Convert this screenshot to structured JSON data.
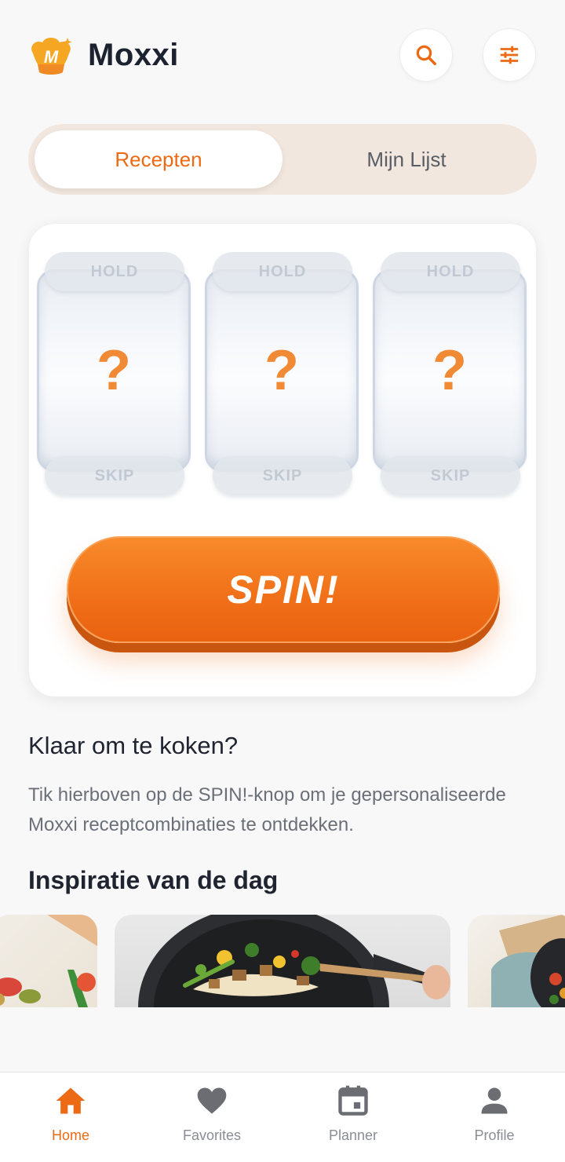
{
  "app": {
    "title": "Moxxi",
    "brand_color": "#EC6A14"
  },
  "header": {
    "search_icon": "search-icon",
    "filter_icon": "sliders-icon"
  },
  "tabs": [
    {
      "label": "Recepten",
      "active": true
    },
    {
      "label": "Mijn Lijst",
      "active": false
    }
  ],
  "slot_machine": {
    "reels": [
      {
        "symbol": "?",
        "hold_label": "HOLD",
        "skip_label": "SKIP"
      },
      {
        "symbol": "?",
        "hold_label": "HOLD",
        "skip_label": "SKIP"
      },
      {
        "symbol": "?",
        "hold_label": "HOLD",
        "skip_label": "SKIP"
      }
    ],
    "spin_label": "SPIN!"
  },
  "intro": {
    "heading": "Klaar om te koken?",
    "body": "Tik hierboven op de SPIN!-knop om je gepersonaliseerde Moxxi receptcombinaties te ontdekken."
  },
  "inspiration": {
    "heading": "Inspiratie van de dag"
  },
  "bottom_nav": [
    {
      "label": "Home",
      "icon": "home-icon",
      "active": true
    },
    {
      "label": "Favorites",
      "icon": "heart-icon",
      "active": false
    },
    {
      "label": "Planner",
      "icon": "calendar-icon",
      "active": false
    },
    {
      "label": "Profile",
      "icon": "person-icon",
      "active": false
    }
  ]
}
